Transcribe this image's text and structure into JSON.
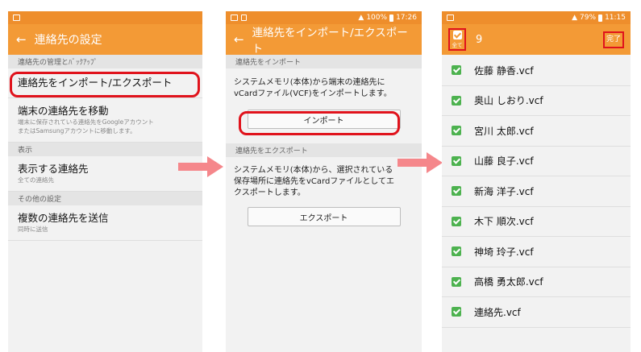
{
  "screen1": {
    "title": "連絡先の設定",
    "sections": [
      {
        "header": "連絡先の管理とﾊﾞｯｸｱｯﾌﾟ",
        "items": [
          {
            "title": "連絡先をインポート/エクスポート",
            "sub": ""
          },
          {
            "title": "端末の連絡先を移動",
            "sub1": "端末に保存されている連絡先をGoogleアカウント",
            "sub2": "またはSamsungアカウントに移動します。"
          }
        ]
      },
      {
        "header": "表示",
        "items": [
          {
            "title": "表示する連絡先",
            "sub": "全ての連絡先"
          }
        ]
      },
      {
        "header": "その他の設定",
        "items": [
          {
            "title": "複数の連絡先を送信",
            "sub": "同時に送信"
          }
        ]
      }
    ]
  },
  "screen2": {
    "status": {
      "battery": "100%",
      "time": "17:26"
    },
    "title": "連絡先をインポート/エクスポート",
    "import": {
      "header": "連絡先をインポート",
      "desc1": "システムメモリ(本体)から端末の連絡先に",
      "desc2": "vCardファイル(VCF)をインポートします。",
      "button": "インポート"
    },
    "export": {
      "header": "連絡先をエクスポート",
      "desc1": "システムメモリ(本体)から、選択されている",
      "desc2": "保存場所に連絡先をvCardファイルとしてエ",
      "desc3": "クスポートします。",
      "button": "エクスポート"
    }
  },
  "screen3": {
    "status": {
      "battery": "79%",
      "time": "11:15"
    },
    "select_all_label": "全て",
    "count": "9",
    "done": "完了",
    "files": [
      "佐藤 静香.vcf",
      "奥山 しおり.vcf",
      "宮川 太郎.vcf",
      "山藤 良子.vcf",
      "新海 洋子.vcf",
      "木下 順次.vcf",
      "神埼 玲子.vcf",
      "高橋 勇太郎.vcf",
      "連絡先.vcf"
    ]
  },
  "colors": {
    "accent": "#f39a36",
    "status_bar": "#ee8e2c",
    "highlight": "#e0131c",
    "check": "#4db24f",
    "arrow": "#f5878b"
  },
  "icons": {
    "back": "arrow-left-icon",
    "check": "checkbox-checked-icon"
  }
}
